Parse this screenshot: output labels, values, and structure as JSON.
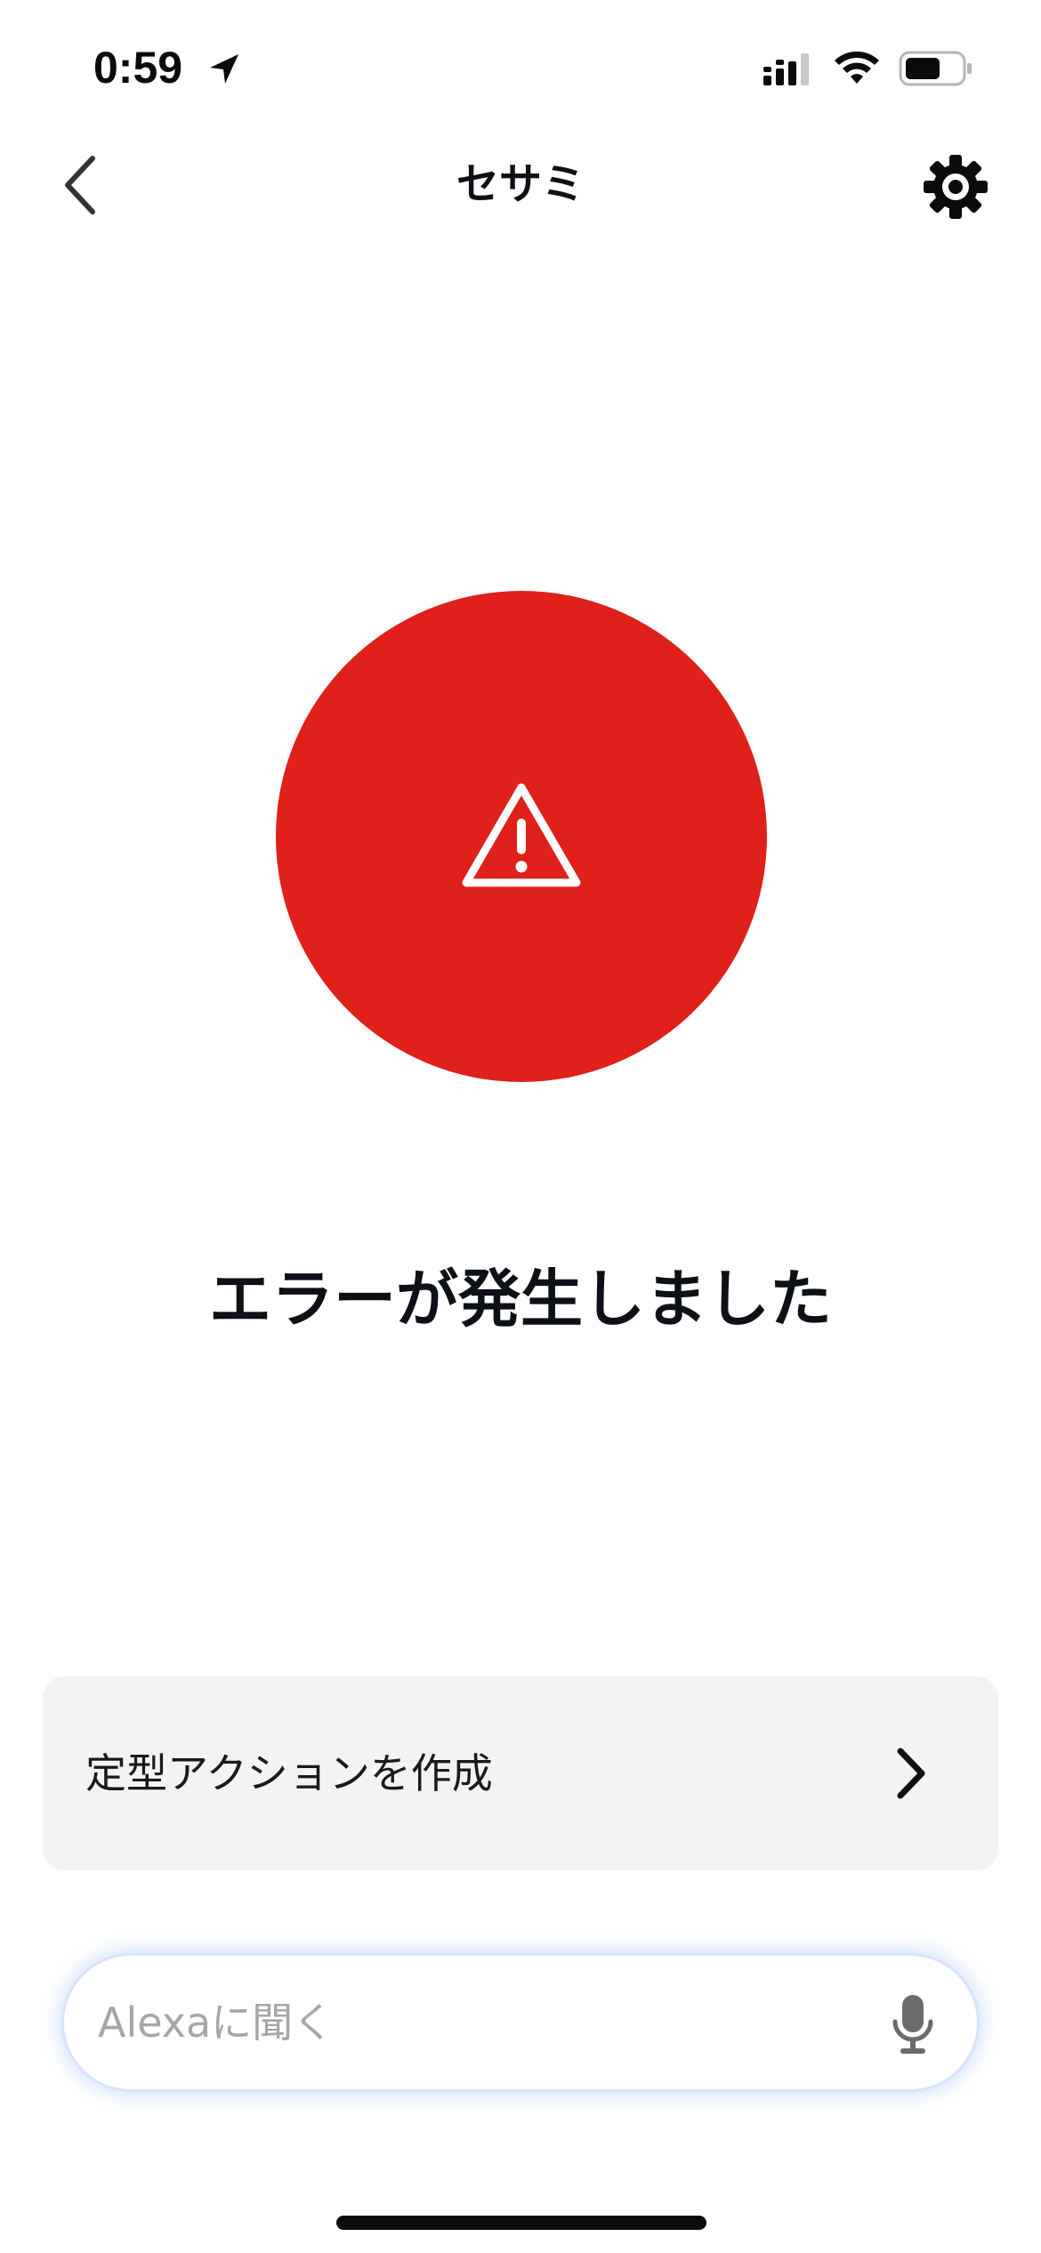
{
  "status_bar": {
    "time": "0:59",
    "icons": [
      "location-arrow-icon",
      "cellular-signal-icon",
      "wifi-icon",
      "battery-icon"
    ]
  },
  "nav": {
    "title": "セサミ",
    "back_icon": "chevron-left-icon",
    "settings_icon": "gear-icon"
  },
  "status": {
    "icon": "warning-triangle-icon",
    "message": "エラーが発生しました",
    "circle_color": "#e0201b"
  },
  "routine": {
    "label": "定型アクションを作成",
    "icon": "chevron-right-icon"
  },
  "alexa": {
    "placeholder": "Alexaに聞く",
    "mic_icon": "microphone-icon"
  }
}
